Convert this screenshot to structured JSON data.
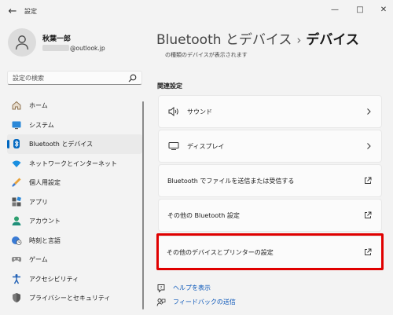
{
  "window": {
    "title": "設定",
    "back_glyph": "←",
    "minimize_glyph": "—",
    "maximize_glyph": "□",
    "close_glyph": "✕"
  },
  "profile": {
    "name": "秋葉一郎",
    "email_suffix": "@outlook.jp"
  },
  "search": {
    "placeholder": "設定の検索"
  },
  "nav": {
    "items": [
      {
        "label": "ホーム",
        "icon": "home-icon",
        "selected": false
      },
      {
        "label": "システム",
        "icon": "system-icon",
        "selected": false
      },
      {
        "label": "Bluetooth とデバイス",
        "icon": "bluetooth-icon",
        "selected": true
      },
      {
        "label": "ネットワークとインターネット",
        "icon": "network-icon",
        "selected": false
      },
      {
        "label": "個人用設定",
        "icon": "personalization-icon",
        "selected": false
      },
      {
        "label": "アプリ",
        "icon": "apps-icon",
        "selected": false
      },
      {
        "label": "アカウント",
        "icon": "account-icon",
        "selected": false
      },
      {
        "label": "時刻と言語",
        "icon": "time-language-icon",
        "selected": false
      },
      {
        "label": "ゲーム",
        "icon": "gaming-icon",
        "selected": false
      },
      {
        "label": "アクセシビリティ",
        "icon": "accessibility-icon",
        "selected": false
      },
      {
        "label": "プライバシーとセキュリティ",
        "icon": "privacy-icon",
        "selected": false
      }
    ]
  },
  "main": {
    "breadcrumb_parent": "Bluetooth とデバイス",
    "breadcrumb_separator": "›",
    "breadcrumb_current": "デバイス",
    "cut_text": "の種類のデバイスが表示されます",
    "section_title": "関連設定",
    "cards": [
      {
        "label": "サウンド",
        "icon": "speaker-icon",
        "action": "chevron-right-icon"
      },
      {
        "label": "ディスプレイ",
        "icon": "monitor-icon",
        "action": "chevron-right-icon"
      },
      {
        "label": "Bluetooth でファイルを送信または受信する",
        "icon": "",
        "action": "external-link-icon"
      },
      {
        "label": "その他の Bluetooth 設定",
        "icon": "",
        "action": "external-link-icon"
      },
      {
        "label": "その他のデバイスとプリンターの設定",
        "icon": "",
        "action": "external-link-icon",
        "highlighted": true
      }
    ],
    "links": [
      {
        "label": "ヘルプを表示",
        "icon": "help-icon"
      },
      {
        "label": "フィードバックの送信",
        "icon": "feedback-icon"
      }
    ]
  },
  "colors": {
    "accent": "#0067c0",
    "highlight_box": "#e00000",
    "link": "#0b57b9",
    "background": "#f3f3f3"
  }
}
